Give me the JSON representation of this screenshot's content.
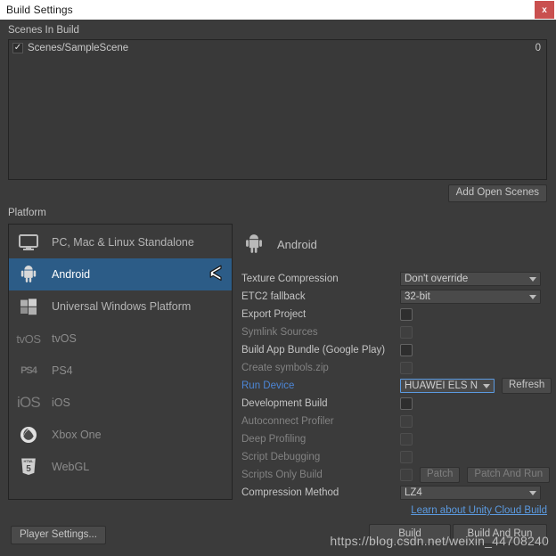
{
  "window": {
    "title": "Build Settings",
    "close_label": "x"
  },
  "scenes_section": {
    "title": "Scenes In Build",
    "check_glyph": "✓",
    "scenes": [
      {
        "name": "Scenes/SampleScene",
        "index": "0",
        "checked": true
      }
    ],
    "add_open_scenes_label": "Add Open Scenes"
  },
  "platform_section": {
    "title": "Platform",
    "items": [
      {
        "label": "PC, Mac & Linux Standalone",
        "icon": "monitor-icon",
        "selected": false,
        "installed": true
      },
      {
        "label": "Android",
        "icon": "android-icon",
        "selected": true,
        "installed": true
      },
      {
        "label": "Universal Windows Platform",
        "icon": "windows-icon",
        "selected": false,
        "installed": true
      },
      {
        "label": "tvOS",
        "icon": "tvos-icon",
        "icon_text": "tvOS",
        "selected": false,
        "installed": false
      },
      {
        "label": "PS4",
        "icon": "ps4-icon",
        "icon_text": "PS4",
        "selected": false,
        "installed": false
      },
      {
        "label": "iOS",
        "icon": "ios-icon",
        "icon_text": "iOS",
        "selected": false,
        "installed": false
      },
      {
        "label": "Xbox One",
        "icon": "xbox-icon",
        "selected": false,
        "installed": false
      },
      {
        "label": "WebGL",
        "icon": "webgl-icon",
        "selected": false,
        "installed": false
      }
    ]
  },
  "settings_panel": {
    "platform_name": "Android",
    "rows": [
      {
        "label": "Texture Compression",
        "type": "dropdown",
        "value": "Don't override",
        "disabled": false
      },
      {
        "label": "ETC2 fallback",
        "type": "dropdown",
        "value": "32-bit",
        "disabled": false
      },
      {
        "label": "Export Project",
        "type": "checkbox",
        "checked": false,
        "disabled": false
      },
      {
        "label": "Symlink Sources",
        "type": "checkbox",
        "checked": false,
        "disabled": true
      },
      {
        "label": "Build App Bundle (Google Play)",
        "type": "checkbox",
        "checked": false,
        "disabled": false
      },
      {
        "label": "Create symbols.zip",
        "type": "checkbox",
        "checked": false,
        "disabled": true
      },
      {
        "label": "Run Device",
        "type": "dropdown-refresh",
        "value": "HUAWEI ELS N",
        "button": "Refresh",
        "disabled": false,
        "link_label": true
      },
      {
        "label": "Development Build",
        "type": "checkbox",
        "checked": false,
        "disabled": false
      },
      {
        "label": "Autoconnect Profiler",
        "type": "checkbox",
        "checked": false,
        "disabled": true
      },
      {
        "label": "Deep Profiling",
        "type": "checkbox",
        "checked": false,
        "disabled": true
      },
      {
        "label": "Script Debugging",
        "type": "checkbox",
        "checked": false,
        "disabled": true
      },
      {
        "label": "Scripts Only Build",
        "type": "checkbox-patch",
        "checked": false,
        "disabled": true,
        "patch": "Patch",
        "patch_and_run": "Patch And Run"
      },
      {
        "label": "Compression Method",
        "type": "dropdown",
        "value": "LZ4",
        "disabled": false
      }
    ],
    "cloud_build_link": "Learn about Unity Cloud Build"
  },
  "footer": {
    "player_settings_label": "Player Settings...",
    "build_label": "Build",
    "build_and_run_label": "Build And Run"
  },
  "watermark": {
    "text": "https://blog.csdn.net/weixin_44708240"
  },
  "colors": {
    "window_bg": "#3b3b3b",
    "selection_blue": "#2c5c87",
    "link_blue": "#5b9ae0",
    "close_red": "#c9504f",
    "titlebar_bg": "#ffffff"
  }
}
